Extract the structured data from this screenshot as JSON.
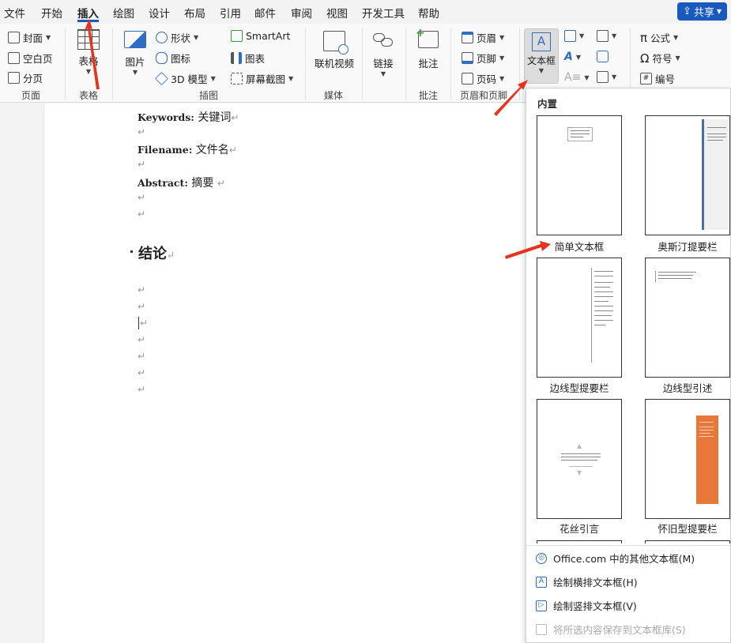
{
  "menu": {
    "tabs": [
      "文件",
      "开始",
      "插入",
      "绘图",
      "设计",
      "布局",
      "引用",
      "邮件",
      "审阅",
      "视图",
      "开发工具",
      "帮助"
    ],
    "share_label": "共享"
  },
  "ribbon": {
    "pages": {
      "cover": "封面",
      "blank": "空白页",
      "break": "分页",
      "label": "页面"
    },
    "tables": {
      "table": "表格",
      "label": "表格"
    },
    "illustrations": {
      "picture": "图片",
      "shapes": "形状",
      "icons": "图标",
      "model3d": "3D 模型",
      "smartart": "SmartArt",
      "chart": "图表",
      "screenshot": "屏幕截图",
      "label": "插图"
    },
    "media": {
      "video": "联机视频",
      "label": "媒体"
    },
    "links": {
      "link": "链接"
    },
    "comments": {
      "comment": "批注",
      "label": "批注"
    },
    "header_footer": {
      "header": "页眉",
      "footer": "页脚",
      "page_number": "页码",
      "label": "页眉和页脚"
    },
    "text": {
      "textbox": "文本框"
    },
    "symbols": {
      "equation": "公式",
      "symbol": "符号",
      "numbering": "编号"
    }
  },
  "document": {
    "keywords_label": "Keywords:",
    "keywords_value": "关键词",
    "filename_label": "Filename:",
    "filename_value": "文件名",
    "abstract_label": "Abstract:",
    "abstract_value": "摘要",
    "heading": "结论",
    "para_mark": "↵"
  },
  "gallery": {
    "section_title": "内置",
    "items": [
      "简单文本框",
      "奥斯汀提要栏",
      "边线型提要栏",
      "边线型引述",
      "花丝引言",
      "怀旧型提要栏"
    ],
    "commands": [
      {
        "label": "Office.com 中的其他文本框(M)",
        "disabled": false
      },
      {
        "label": "绘制横排文本框(H)",
        "disabled": false
      },
      {
        "label": "绘制竖排文本框(V)",
        "disabled": false
      },
      {
        "label": "将所选内容保存到文本框库(S)",
        "disabled": true
      }
    ]
  },
  "colors": {
    "accent": "#185abd",
    "annotation_arrow": "#e8331c",
    "vintage_sidebar": "#e8783a"
  }
}
